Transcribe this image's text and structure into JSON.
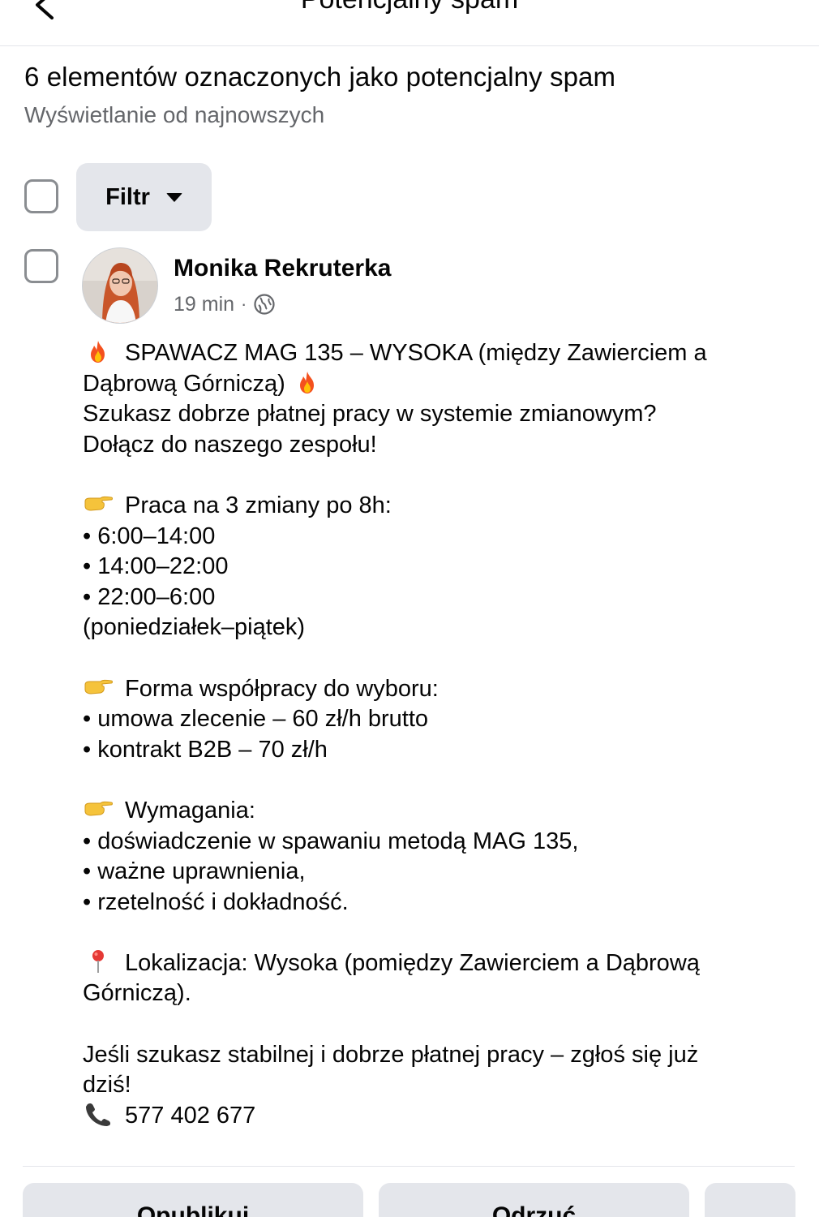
{
  "nav": {
    "title": "Potencjalny spam",
    "back_icon": "chevron-left-icon"
  },
  "header": {
    "title": "6 elementów oznaczonych jako potencjalny spam",
    "subtitle": "Wyświetlanie od najnowszych"
  },
  "toolbar": {
    "filter_label": "Filtr",
    "filter_icon": "caret-down-icon"
  },
  "post": {
    "author": "Monika Rekruterka",
    "time": "19 min",
    "separator": "·",
    "audience_icon": "globe-icon",
    "lines": [
      {
        "emoji": "fire",
        "text": "SPAWACZ MAG 135 – WYSOKA (między Zawierciem a"
      },
      {
        "emoji_after": "fire",
        "text": "Dąbrową Górniczą) "
      },
      {
        "text": "Szukasz dobrze płatnej pracy w systemie zmianowym?"
      },
      {
        "text": "Dołącz do naszego zespołu!"
      },
      {
        "text": ""
      },
      {
        "emoji": "point-right",
        "text": "Praca na 3 zmiany po 8h:"
      },
      {
        "text": "• 6:00–14:00"
      },
      {
        "text": "• 14:00–22:00"
      },
      {
        "text": "• 22:00–6:00"
      },
      {
        "text": "(poniedziałek–piątek)"
      },
      {
        "text": ""
      },
      {
        "emoji": "point-right",
        "text": "Forma współpracy do wyboru:"
      },
      {
        "text": "• umowa zlecenie – 60 zł/h brutto"
      },
      {
        "text": "• kontrakt B2B – 70 zł/h"
      },
      {
        "text": ""
      },
      {
        "emoji": "point-right",
        "text": "Wymagania:"
      },
      {
        "text": "• doświadczenie w spawaniu metodą MAG 135,"
      },
      {
        "text": "• ważne uprawnienia,"
      },
      {
        "text": "• rzetelność i dokładność."
      },
      {
        "text": ""
      },
      {
        "emoji": "pin",
        "text": "Lokalizacja: Wysoka (pomiędzy Zawierciem a Dąbrową"
      },
      {
        "text": "Górniczą)."
      },
      {
        "text": ""
      },
      {
        "text": "Jeśli szukasz stabilnej i dobrze płatnej pracy – zgłoś się już"
      },
      {
        "text": "dziś!"
      },
      {
        "emoji": "phone",
        "text": "577 402 677"
      }
    ]
  },
  "actions": {
    "publish_label": "Opublikuj",
    "reject_label": "Odrzuć",
    "more_label": "..."
  },
  "colors": {
    "button_bg": "#e4e6eb",
    "secondary_text": "#65676b",
    "primary_text": "#050505"
  }
}
